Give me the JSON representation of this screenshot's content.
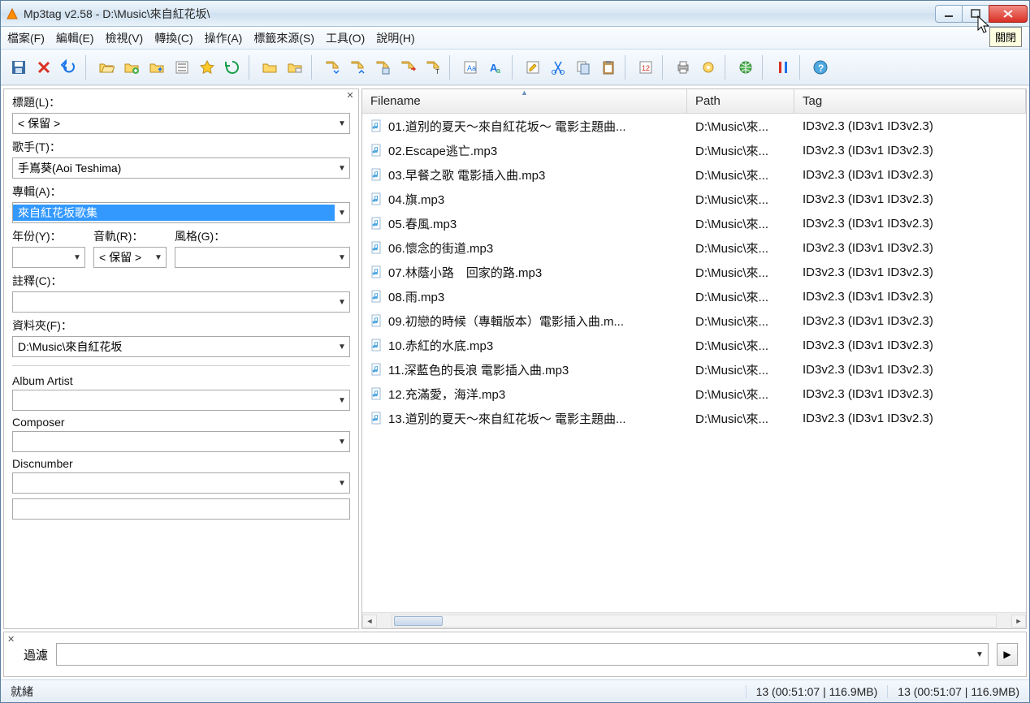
{
  "window": {
    "title": "Mp3tag v2.58  -  D:\\Music\\來自紅花坂\\",
    "close_tooltip": "關閉"
  },
  "menu": {
    "items": [
      "檔案(F)",
      "編輯(E)",
      "檢視(V)",
      "轉換(C)",
      "操作(A)",
      "標籤來源(S)",
      "工具(O)",
      "說明(H)"
    ]
  },
  "tag_panel": {
    "title_label": "標題(L)：",
    "title_value": "< 保留 >",
    "artist_label": "歌手(T)：",
    "artist_value": "手嶌葵(Aoi Teshima)",
    "album_label": "專輯(A)：",
    "album_value": "來自紅花坂歌集",
    "year_label": "年份(Y)：",
    "year_value": "",
    "track_label": "音軌(R)：",
    "track_value": "< 保留 >",
    "genre_label": "風格(G)：",
    "genre_value": "",
    "comment_label": "註釋(C)：",
    "comment_value": "",
    "folder_label": "資料夾(F)：",
    "folder_value": "D:\\Music\\來自紅花坂",
    "album_artist_label": "Album Artist",
    "album_artist_value": "",
    "composer_label": "Composer",
    "composer_value": "",
    "discnumber_label": "Discnumber",
    "discnumber_value": ""
  },
  "list": {
    "columns": [
      "Filename",
      "Path",
      "Tag"
    ],
    "rows": [
      {
        "filename": "01.道別的夏天～來自紅花坂～ 電影主題曲...",
        "path": "D:\\Music\\來...",
        "tag": "ID3v2.3 (ID3v1 ID3v2.3)"
      },
      {
        "filename": "02.Escape逃亡.mp3",
        "path": "D:\\Music\\來...",
        "tag": "ID3v2.3 (ID3v1 ID3v2.3)"
      },
      {
        "filename": "03.早餐之歌 電影插入曲.mp3",
        "path": "D:\\Music\\來...",
        "tag": "ID3v2.3 (ID3v1 ID3v2.3)"
      },
      {
        "filename": "04.旗.mp3",
        "path": "D:\\Music\\來...",
        "tag": "ID3v2.3 (ID3v1 ID3v2.3)"
      },
      {
        "filename": "05.春風.mp3",
        "path": "D:\\Music\\來...",
        "tag": "ID3v2.3 (ID3v1 ID3v2.3)"
      },
      {
        "filename": "06.懷念的街道.mp3",
        "path": "D:\\Music\\來...",
        "tag": "ID3v2.3 (ID3v1 ID3v2.3)"
      },
      {
        "filename": "07.林蔭小路　回家的路.mp3",
        "path": "D:\\Music\\來...",
        "tag": "ID3v2.3 (ID3v1 ID3v2.3)"
      },
      {
        "filename": "08.雨.mp3",
        "path": "D:\\Music\\來...",
        "tag": "ID3v2.3 (ID3v1 ID3v2.3)"
      },
      {
        "filename": "09.初戀的時候（專輯版本）電影插入曲.m...",
        "path": "D:\\Music\\來...",
        "tag": "ID3v2.3 (ID3v1 ID3v2.3)"
      },
      {
        "filename": "10.赤紅的水底.mp3",
        "path": "D:\\Music\\來...",
        "tag": "ID3v2.3 (ID3v1 ID3v2.3)"
      },
      {
        "filename": "11.深藍色的長浪 電影插入曲.mp3",
        "path": "D:\\Music\\來...",
        "tag": "ID3v2.3 (ID3v1 ID3v2.3)"
      },
      {
        "filename": "12.充滿愛，海洋.mp3",
        "path": "D:\\Music\\來...",
        "tag": "ID3v2.3 (ID3v1 ID3v2.3)"
      },
      {
        "filename": "13.道別的夏天～來自紅花坂～ 電影主題曲...",
        "path": "D:\\Music\\來...",
        "tag": "ID3v2.3 (ID3v1 ID3v2.3)"
      }
    ]
  },
  "filter": {
    "label": "過濾",
    "value": ""
  },
  "status": {
    "left": "就緒",
    "mid": "13 (00:51:07 | 116.9MB)",
    "right": "13 (00:51:07 | 116.9MB)"
  }
}
